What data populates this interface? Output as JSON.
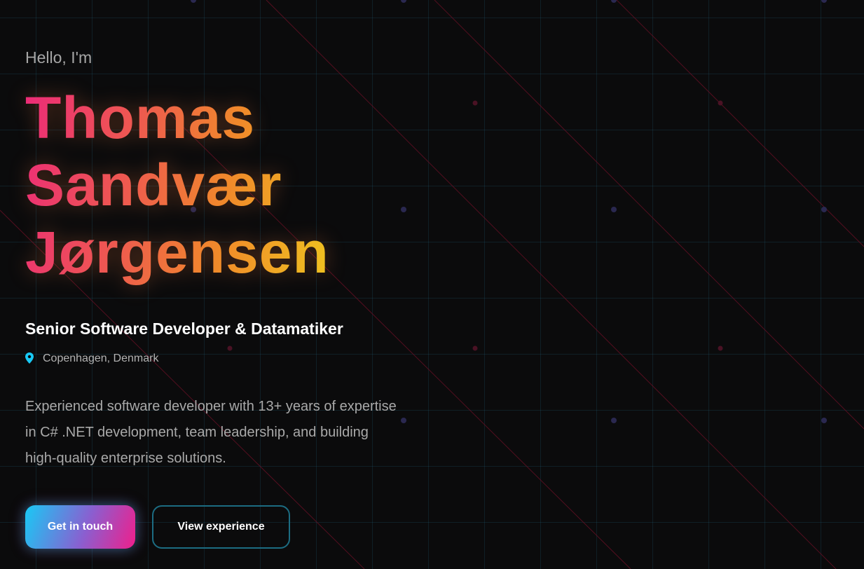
{
  "hero": {
    "greeting": "Hello, I'm",
    "name_lines": [
      "Thomas",
      "Sandvær",
      "Jørgensen"
    ],
    "role": "Senior Software Developer & Datamatiker",
    "location": "Copenhagen, Denmark",
    "bio": "Experienced software developer with 13+ years of expertise in C# .NET development, team leadership, and building high-quality enterprise solutions."
  },
  "buttons": {
    "primary_label": "Get in touch",
    "secondary_label": "View experience"
  },
  "icons": {
    "location": "map-pin-icon"
  },
  "colors": {
    "background": "#0b0b0c",
    "grid_line": "#226e8c",
    "name_gradient": [
      "#ec2b78",
      "#f08a2a",
      "#eef21c"
    ],
    "accent_cyan": "#19c9f5",
    "accent_pink": "#ef1f8b",
    "secondary_border": "#1c6c82",
    "pin": "#19c9f5"
  }
}
